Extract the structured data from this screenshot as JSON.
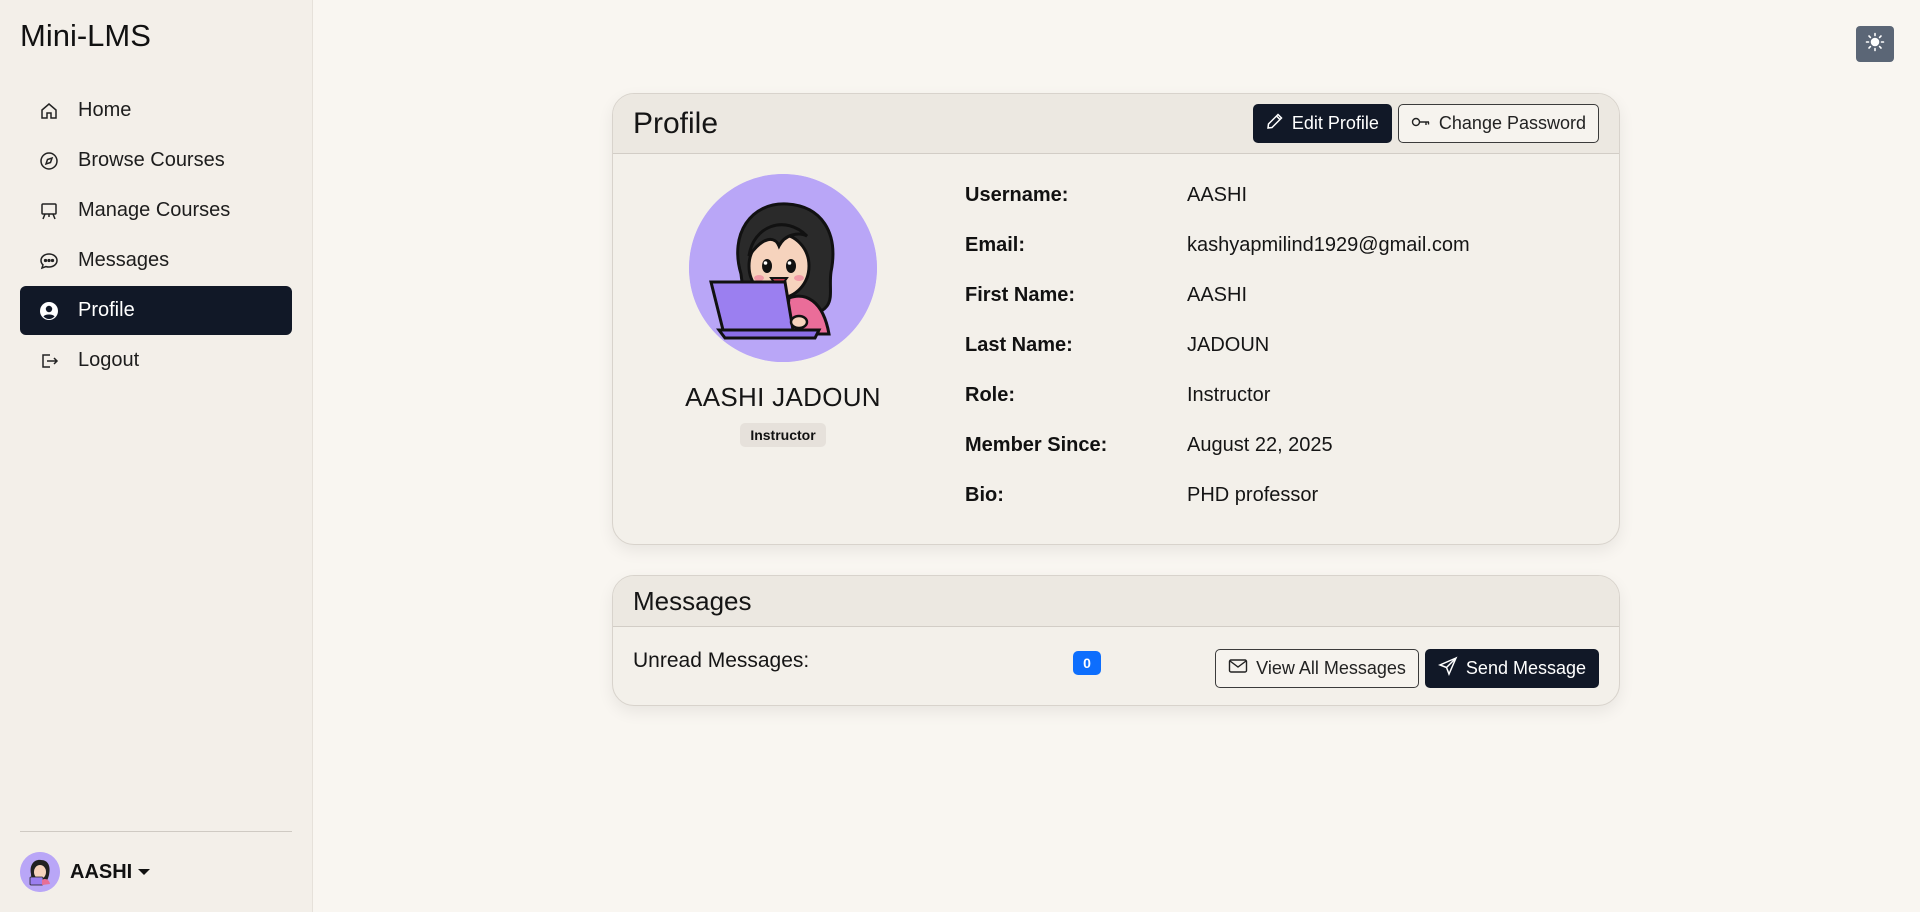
{
  "app": {
    "title": "Mini-LMS"
  },
  "sidebar": {
    "items": [
      {
        "label": "Home",
        "icon": "home-icon",
        "active": false
      },
      {
        "label": "Browse Courses",
        "icon": "compass-icon",
        "active": false
      },
      {
        "label": "Manage Courses",
        "icon": "easel-icon",
        "active": false
      },
      {
        "label": "Messages",
        "icon": "chat-dots-icon",
        "active": false
      },
      {
        "label": "Profile",
        "icon": "person-circle-icon",
        "active": true
      },
      {
        "label": "Logout",
        "icon": "logout-icon",
        "active": false
      }
    ],
    "user": {
      "name": "AASHI"
    }
  },
  "theme_toggle": {
    "icon": "sun-icon"
  },
  "profile_card": {
    "title": "Profile",
    "edit_label": "Edit Profile",
    "change_password_label": "Change Password",
    "full_name": "AASHI JADOUN",
    "role_badge": "Instructor",
    "fields": [
      {
        "label": "Username:",
        "value": "AASHI"
      },
      {
        "label": "Email:",
        "value": "kashyapmilind1929@gmail.com"
      },
      {
        "label": "First Name:",
        "value": "AASHI"
      },
      {
        "label": "Last Name:",
        "value": "JADOUN"
      },
      {
        "label": "Role:",
        "value": "Instructor"
      },
      {
        "label": "Member Since:",
        "value": "August 22, 2025"
      },
      {
        "label": "Bio:",
        "value": "PHD professor"
      }
    ]
  },
  "messages_card": {
    "title": "Messages",
    "unread_label": "Unread Messages:",
    "unread_count": "0",
    "view_all_label": "View All Messages",
    "send_label": "Send Message"
  },
  "colors": {
    "primary_dark": "#111827",
    "badge_blue": "#0d6efd",
    "avatar_bg": "#b9a6f7",
    "page_bg": "#f9f6f1"
  }
}
